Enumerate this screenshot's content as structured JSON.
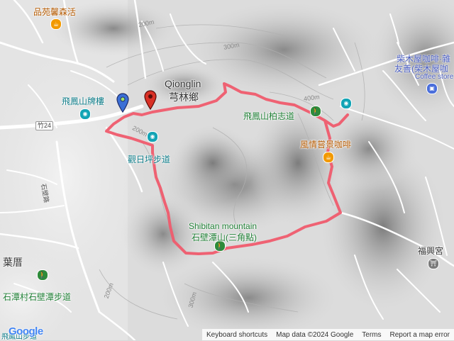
{
  "places": {
    "pinzhu": "品苑馨森活",
    "feifeng_gate": "飛鳳山牌樓",
    "qionglin_en": "Qionglin",
    "qionglin_zh": "芎林鄉",
    "trail_a": "觀日坪步道",
    "feifeng_trail": "飛鳳山柏志道",
    "fengqing_cafe": "風情嘗景咖啡",
    "chaimu_1": "柴木屋咖啡·雜",
    "chaimu_2": "友善(柴木屋咖",
    "coffee_store": "Coffee store",
    "shibitan_en": "Shibitan mountain",
    "shibitan_zh": "石壁潭山(三角點)",
    "fuxing": "福興宮",
    "yecuo": "葉厝",
    "shitan_trail": "石潭村石壁潭步道",
    "shibi_road": "石壁路",
    "bottom_cut": "飛鳳山步道"
  },
  "roads": {
    "route24": "竹24"
  },
  "contours": {
    "c200a": "200m",
    "c200b": "200m",
    "c300a": "300m",
    "c400": "400m",
    "c200c": "200m",
    "c300b": "300m"
  },
  "attribution": {
    "logo": "Google",
    "shortcuts": "Keyboard shortcuts",
    "mapdata": "Map data ©2024 Google",
    "terms": "Terms",
    "report": "Report a map error"
  },
  "colors": {
    "track": "#ef5b6d",
    "start_marker": "#3b6fd6",
    "end_marker": "#d93025"
  }
}
